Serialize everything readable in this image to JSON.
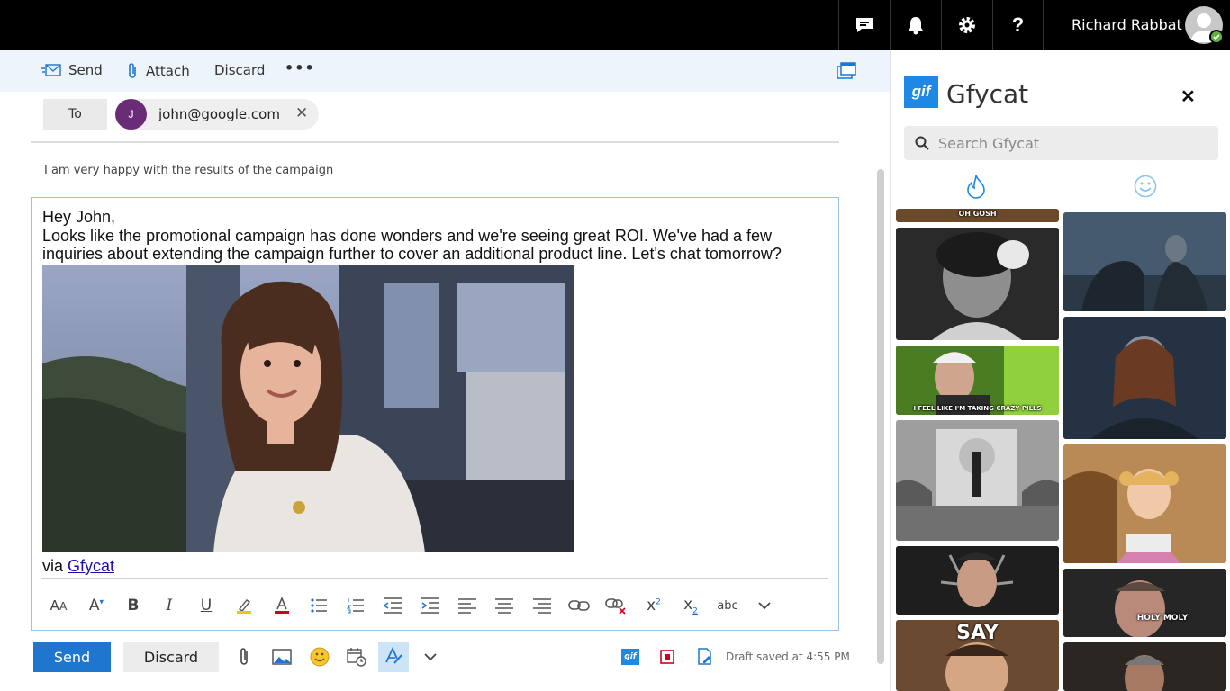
{
  "topbar": {
    "user_name": "Richard Rabbat"
  },
  "compose_toolbar": {
    "send": "Send",
    "attach": "Attach",
    "discard": "Discard",
    "more": "•••"
  },
  "recipients": {
    "to_label": "To",
    "avatar_initial": "J",
    "email": "john@google.com"
  },
  "subject": "I am very happy with the results of the campaign",
  "body": {
    "line1": "Hey John,",
    "line2": "Looks like the promotional campaign has done wonders and we're seeing great ROI. We've had a few inquiries about extending the campaign further to cover an additional product line. Let's chat tomorrow?",
    "via_prefix": "via ",
    "via_link": "Gfycat"
  },
  "format_bar": {
    "bold": "B",
    "italic": "I",
    "underline": "U",
    "strike": "abc"
  },
  "bottom_bar": {
    "send": "Send",
    "discard": "Discard",
    "draft_status": "Draft saved at 4:55 PM"
  },
  "gfycat": {
    "logo_text": "gif",
    "title": "Gfycat",
    "search_placeholder": "Search Gfycat",
    "captions": {
      "ohgosh": "OH GOSH",
      "crazy_pills": "I FEEL LIKE I'M TAKING CRAZY PILLS",
      "say": "SAY",
      "holy_moly": "HOLY MOLY"
    }
  }
}
